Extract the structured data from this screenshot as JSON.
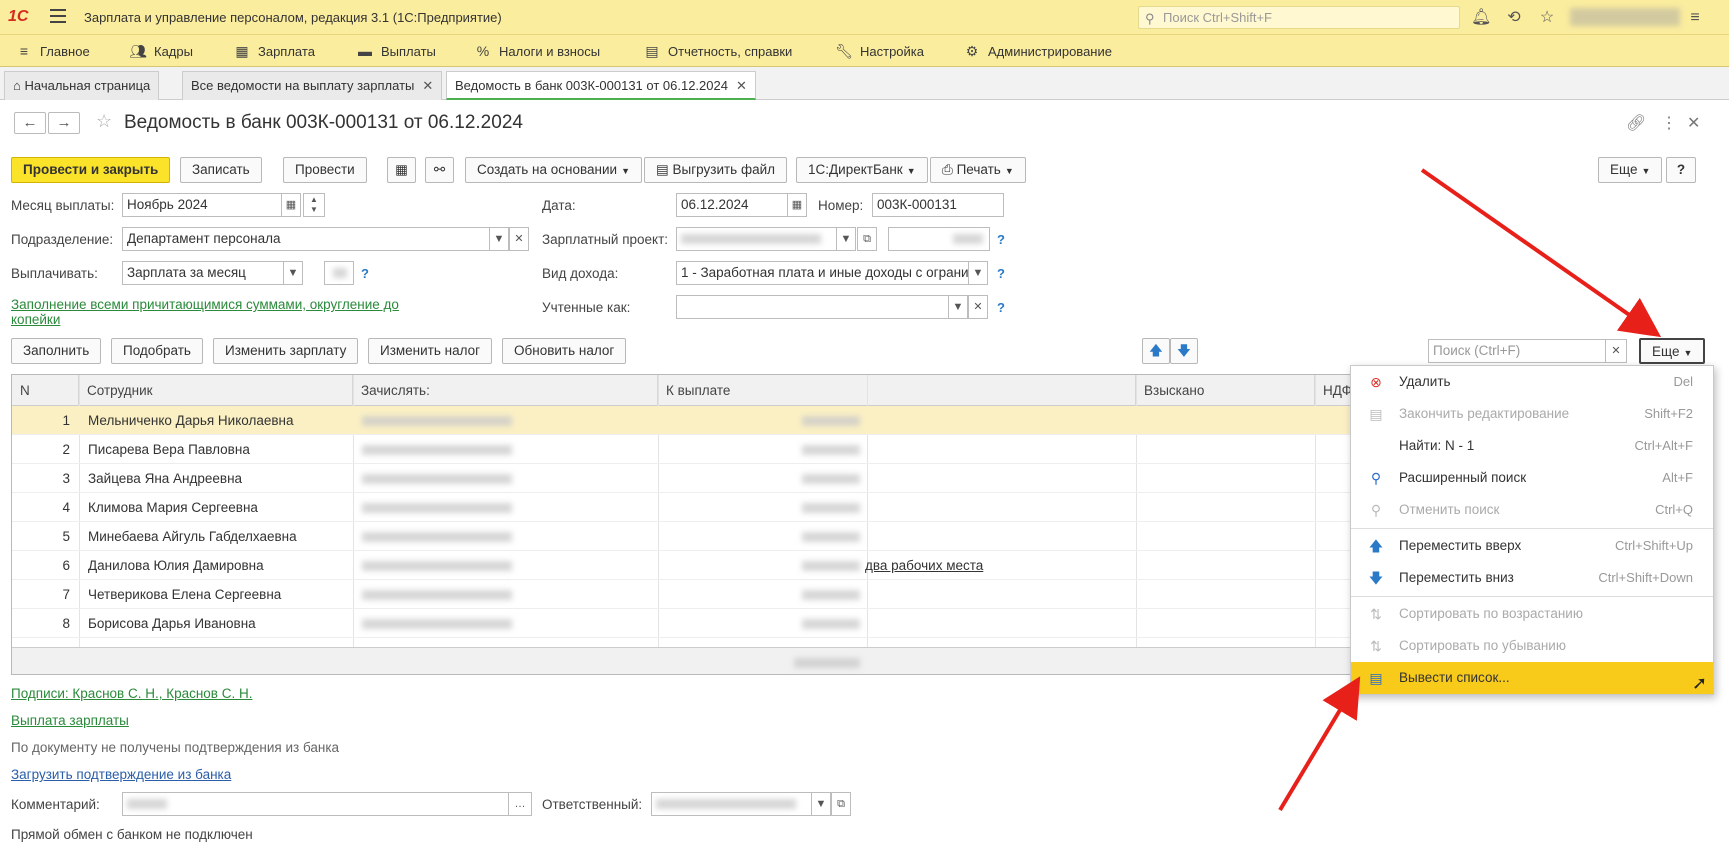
{
  "titlebar": {
    "logo": "1С",
    "title": "Зарплата и управление персоналом, редакция 3.1  (1С:Предприятие)",
    "search_placeholder": "Поиск Ctrl+Shift+F"
  },
  "sections": [
    {
      "label": "Главное",
      "icon": "menu-icon"
    },
    {
      "label": "Кадры",
      "icon": "people-icon"
    },
    {
      "label": "Зарплата",
      "icon": "calculator-icon"
    },
    {
      "label": "Выплаты",
      "icon": "wallet-icon"
    },
    {
      "label": "Налоги и взносы",
      "icon": "percent-icon"
    },
    {
      "label": "Отчетность, справки",
      "icon": "reports-icon"
    },
    {
      "label": "Настройка",
      "icon": "wrench-icon"
    },
    {
      "label": "Администрирование",
      "icon": "gear-icon"
    }
  ],
  "tabs": [
    {
      "label": "Начальная страница"
    },
    {
      "label": "Все ведомости на выплату зарплаты"
    },
    {
      "label": "Ведомость в банк 003К-000131 от 06.12.2024"
    }
  ],
  "document": {
    "title": "Ведомость в банк 003К-000131 от 06.12.2024"
  },
  "toolbar": {
    "post_close": "Провести и закрыть",
    "save": "Записать",
    "post": "Провести",
    "create_based": "Создать на основании",
    "export_file": "Выгрузить файл",
    "direct_bank": "1С:ДиректБанк",
    "print": "Печать",
    "more": "Еще",
    "help": "?"
  },
  "form": {
    "month_label": "Месяц выплаты:",
    "month_value": "Ноябрь 2024",
    "date_label": "Дата:",
    "date_value": "06.12.2024",
    "number_label": "Номер:",
    "number_value": "003К-000131",
    "dept_label": "Подразделение:",
    "dept_value": "Департамент персонала",
    "project_label": "Зарплатный проект:",
    "pay_label": "Выплачивать:",
    "pay_value": "Зарплата за месяц",
    "income_label": "Вид дохода:",
    "income_value": "1 - Заработная плата и иные доходы с ограни",
    "counted_label": "Учтенные как:",
    "fill_link_1": "Заполнение всеми причитающимися суммами, округление до",
    "fill_link_2": "копейки"
  },
  "table_toolbar": {
    "fill": "Заполнить",
    "pick": "Подобрать",
    "change_salary": "Изменить зарплату",
    "change_tax": "Изменить налог",
    "update_tax": "Обновить налог",
    "search_placeholder": "Поиск (Ctrl+F)",
    "more": "Еще"
  },
  "table": {
    "columns": [
      "N",
      "Сотрудник",
      "Зачислять:",
      "К выплате",
      "Взыскано",
      "НДФЛ"
    ],
    "rows": [
      {
        "n": "1",
        "employee": "Мельниченко Дарья Николаевна",
        "note": ""
      },
      {
        "n": "2",
        "employee": "Писарева Вера Павловна",
        "note": ""
      },
      {
        "n": "3",
        "employee": "Зайцева Яна Андреевна",
        "note": ""
      },
      {
        "n": "4",
        "employee": "Климова Мария Сергеевна",
        "note": ""
      },
      {
        "n": "5",
        "employee": "Минебаева Айгуль Габделхаевна",
        "note": ""
      },
      {
        "n": "6",
        "employee": "Данилова Юлия Дамировна",
        "note": "два рабочих места"
      },
      {
        "n": "7",
        "employee": "Четверикова Елена Сергеевна",
        "note": ""
      },
      {
        "n": "8",
        "employee": "Борисова Дарья Ивановна",
        "note": ""
      }
    ]
  },
  "context_menu": {
    "items": [
      {
        "label": "Удалить",
        "shortcut": "Del",
        "icon": "delete-icon",
        "enabled": true
      },
      {
        "label": "Закончить редактирование",
        "shortcut": "Shift+F2",
        "icon": "end-edit-icon",
        "enabled": false
      },
      {
        "label": "Найти: N - 1",
        "shortcut": "Ctrl+Alt+F",
        "icon": "",
        "enabled": true
      },
      {
        "label": "Расширенный поиск",
        "shortcut": "Alt+F",
        "icon": "search-icon",
        "enabled": true
      },
      {
        "label": "Отменить поиск",
        "shortcut": "Ctrl+Q",
        "icon": "cancel-search-icon",
        "enabled": false
      },
      {
        "label": "Переместить вверх",
        "shortcut": "Ctrl+Shift+Up",
        "icon": "arrow-up-icon",
        "enabled": true
      },
      {
        "label": "Переместить вниз",
        "shortcut": "Ctrl+Shift+Down",
        "icon": "arrow-down-icon",
        "enabled": true
      },
      {
        "label": "Сортировать по возрастанию",
        "shortcut": "",
        "icon": "sort-asc-icon",
        "enabled": false
      },
      {
        "label": "Сортировать по убыванию",
        "shortcut": "",
        "icon": "sort-desc-icon",
        "enabled": false
      },
      {
        "label": "Вывести список...",
        "shortcut": "",
        "icon": "list-output-icon",
        "enabled": true
      }
    ]
  },
  "bottom": {
    "signatures_link": "Подписи: Краснов С. Н., Краснов С. Н.",
    "payout_link": "Выплата зарплаты",
    "no_confirm_text": "По документу не получены подтверждения из банка",
    "load_confirm_link": "Загрузить подтверждение из банка",
    "comment_label": "Комментарий:",
    "responsible_label": "Ответственный:",
    "exchange_text": "Прямой обмен с банком не подключен"
  },
  "colors": {
    "header_bg": "#fbed9e",
    "primary_button": "#fbe32a",
    "highlight": "#f8cb1b",
    "selected_row": "#fbf0c4",
    "link_green": "#2a8a3a",
    "annotation_arrow": "#e8201a"
  }
}
